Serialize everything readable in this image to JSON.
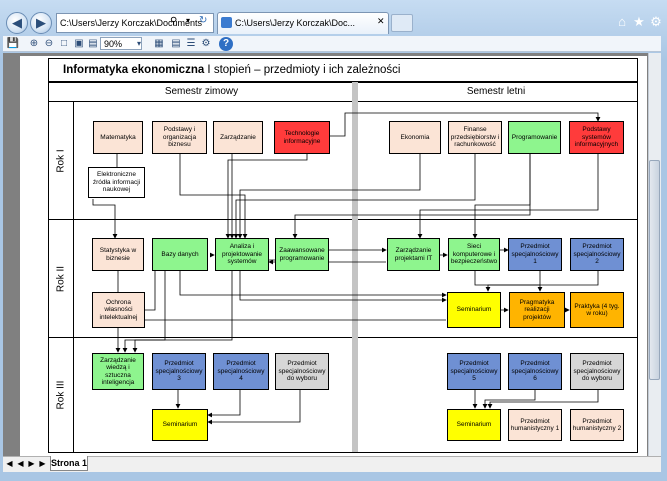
{
  "browser": {
    "address": "C:\\Users\\Jerzy Korczak\\Documents",
    "tab_title": "C:\\Users\\Jerzy Korczak\\Doc...",
    "zoom": "90%"
  },
  "sheet": {
    "tab_label": "Strona 1"
  },
  "diagram": {
    "title_bold": "Informatyka ekonomiczna",
    "title_rest": " I stopień – przedmioty i ich zależności",
    "semester_winter": "Semestr zimowy",
    "semester_summer": "Semestr letni",
    "rows": [
      "Rok I",
      "Rok II",
      "Rok III"
    ],
    "boxes": {
      "matematyka": "Matematyka",
      "podstawy_org": "Podstawy i organizacja biznesu",
      "zarzadzanie": "Zarządzanie",
      "technologie": "Technologie informacyjne",
      "ekonomia": "Ekonomia",
      "finanse": "Finanse przedsiębiorstw i rachunkowość",
      "programowanie": "Programowanie",
      "podstawy_sys": "Podstawy systemów informacyjnych",
      "elektroniczne": "Elektroniczne źródła informacji naukowej",
      "statystyka": "Statystyka w biznesie",
      "bazy": "Bazy danych",
      "analiza": "Analiza i projektowanie systemów",
      "zaawansowane": "Zaawansowane programowanie",
      "zarz_projektami": "Zarządzanie projektami IT",
      "sieci": "Sieci komputerowe i bezpieczeństwo",
      "spec1_r2": "Przedmiot specjalnościowy 1",
      "spec2_r2": "Przedmiot specjalnościowy 2",
      "ochrona": "Ochrona własności intelektualnej",
      "seminarium_r2": "Seminarium",
      "pragmatyka": "Pragmatyka realizacji projektów",
      "praktyka": "Praktyka (4 tyg. w roku)",
      "zarz_wiedza": "Zarządzanie wiedzą i sztuczna inteligencja",
      "spec3": "Przedmiot specjalnościowy 3",
      "spec4": "Przedmiot specjalnościowy 4",
      "spec_wyb_w": "Przedmiot specjalnościowy do wyboru",
      "seminarium_w": "Seminarium",
      "spec5": "Przedmiot specjalnościowy 5",
      "spec6": "Przedmiot specjalnościowy 6",
      "spec_wyb_s": "Przedmiot specjalnościowy do wyboru",
      "seminarium_s": "Seminarium",
      "hum1": "Przedmiot humanistyczny 1",
      "hum2": "Przedmiot humanistyczny 2"
    }
  }
}
